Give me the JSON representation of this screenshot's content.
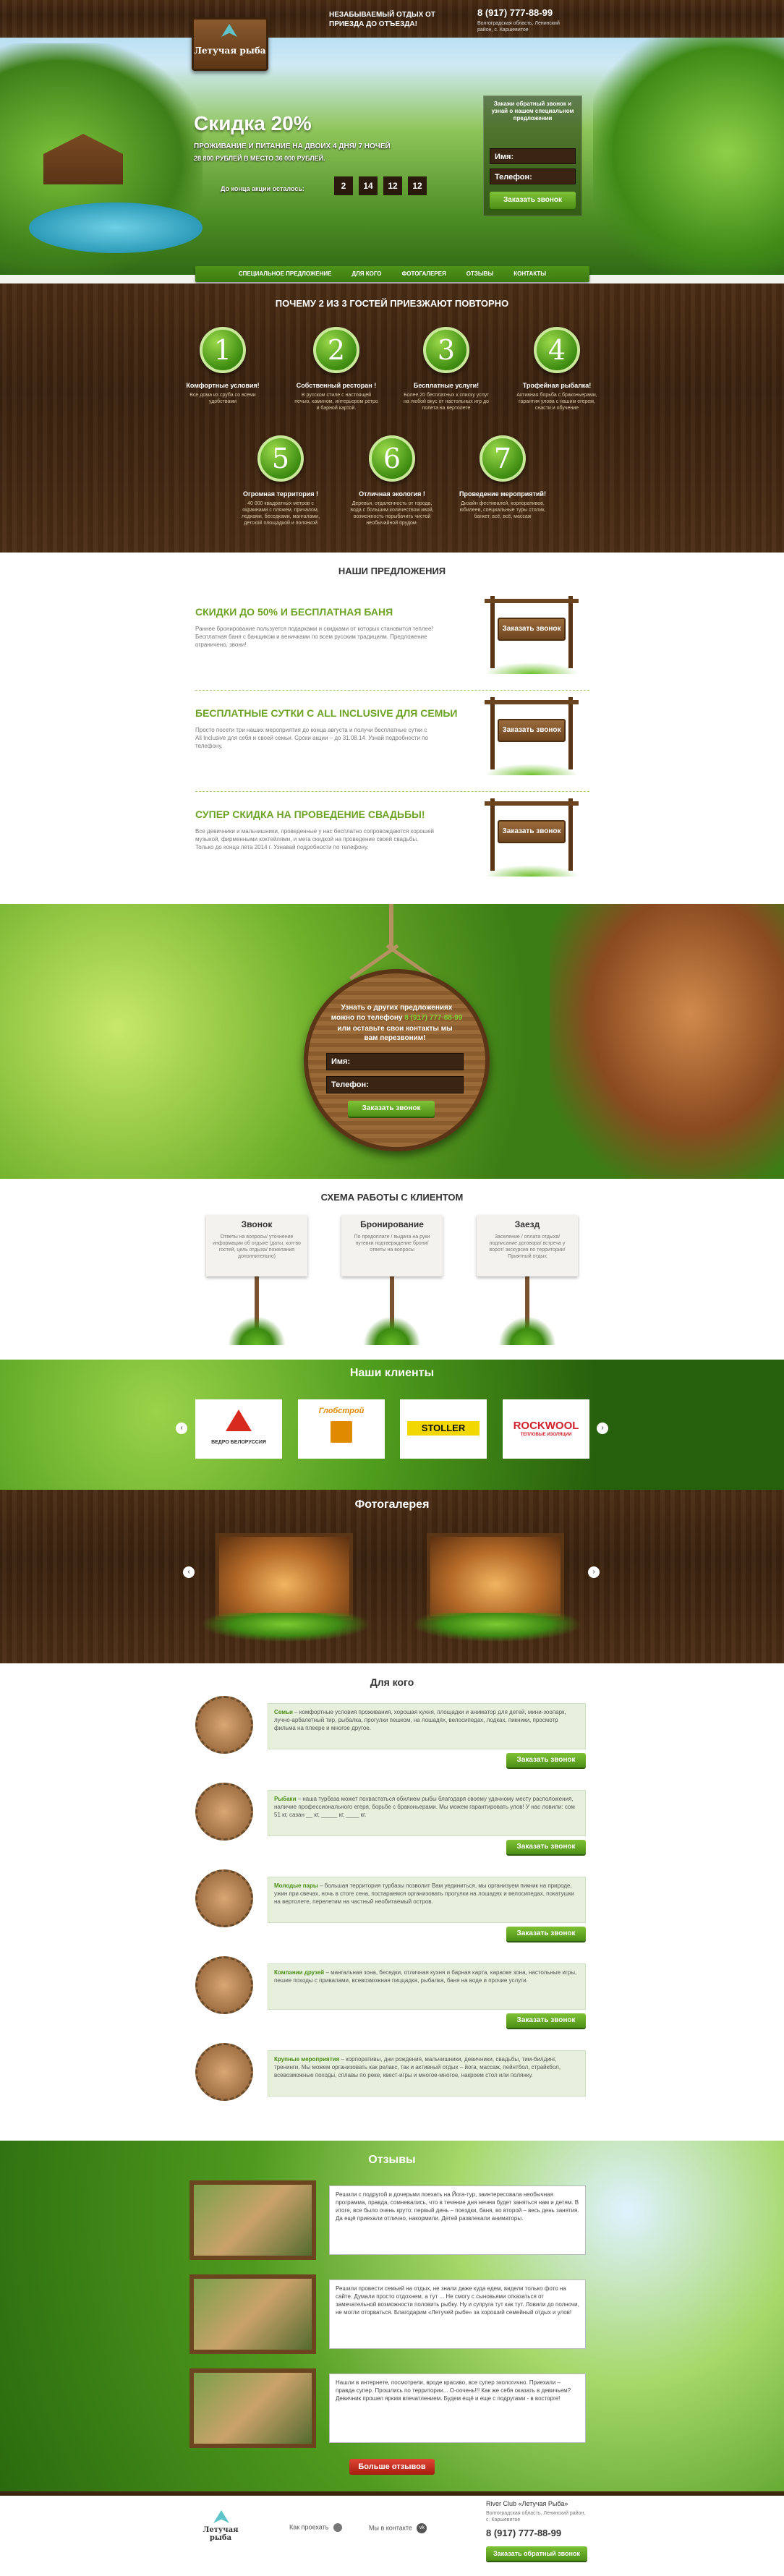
{
  "header": {
    "logo": "Летучая рыба",
    "tagline": "НЕЗАБЫВАЕМЫЙ ОТДЫХ ОТ ПРИЕЗДА ДО ОТЪЕЗДА!",
    "address": "Волгоградская область, Ленинский район, с. Каршевитое",
    "phone": "8 (917) 777-88-99"
  },
  "hero": {
    "discount": "Скидка 20%",
    "subtitle": "ПРОЖИВАНИЕ И ПИТАНИЕ НА ДВОИХ 4 ДНЯ/ 7 НОЧЕЙ",
    "price": "28 800 РУБЛЕЙ В МЕСТО  36 000 РУБЛЕЙ.",
    "countdown_label": "До конца акции осталось:",
    "countdown": [
      "2",
      "14",
      "12",
      "12"
    ],
    "form_title": "Закажи обратный звонок и узнай о нашем специальном предложении",
    "name_label": "Имя:",
    "phone_label": "Телефон:",
    "button": "Заказать звонок"
  },
  "nav": [
    "СПЕЦИАЛЬНОЕ ПРЕДЛОЖЕНИЕ",
    "ДЛЯ КОГО",
    "ФОТОГАЛЕРЕЯ",
    "ОТЗЫВЫ",
    "КОНТАКТЫ"
  ],
  "why": {
    "title": "ПОЧЕМУ 2 ИЗ 3 ГОСТЕЙ ПРИЕЗЖАЮТ ПОВТОРНО",
    "items": [
      {
        "num": "1",
        "title": "Комфортные условия!",
        "desc": "Все дома из сруба со всеми удобствами"
      },
      {
        "num": "2",
        "title": "Собственный ресторан !",
        "desc": "В русском стиле с настоящей печью, камином, интерьером ретро и барной картой."
      },
      {
        "num": "3",
        "title": "Бесплатные услуги!",
        "desc": "Более 20 бесплатных к списку услуг на любой вкус от настольных игр до полета на вертолете"
      },
      {
        "num": "4",
        "title": "Трофейная рыбалка!",
        "desc": "Активная борьба с браконьерами, гарантия улова с нашим егерем, снасти и обучение"
      },
      {
        "num": "5",
        "title": "Огромная территория !",
        "desc": "40 000 квадратных метров с окраинами с пляжем, причалом, лодками, беседками, мангалами, детской площадкой и полянкой"
      },
      {
        "num": "6",
        "title": "Отличная экология !",
        "desc": "Деревья, отдаленность от города, вода с большим количеством ивой, возможность порыбачить чистой необычайной прудом."
      },
      {
        "num": "7",
        "title": "Проведение мероприятий!",
        "desc": "Дизайн фестивалей, корпоративов, юбилеев, специальные туры столик, банкет, всё, всё, массаж"
      }
    ]
  },
  "offers": {
    "title": "НАШИ ПРЕДЛОЖЕНИЯ",
    "sign": "Заказать звонок",
    "items": [
      {
        "title": "СКИДКИ ДО 50% И БЕСПЛАТНАЯ БАНЯ",
        "desc": "Раннее бронирование пользуется подарками и скидками от которых становится теплее! Бесплатная баня с банщиком и веничками по всем русским традициям. Предложение ограничено, звони!"
      },
      {
        "title": "БЕСПЛАТНЫЕ СУТКИ С ALL INCLUSIVE ДЛЯ СЕМЬИ",
        "desc": "Просто посети три наших мероприятия до конца августа и получи бесплатные сутки с All Inclusive для себя и своей семьи. Сроки акции – до 31.08.14. Узнай подробности по телефону."
      },
      {
        "title": "СУПЕР СКИДКА НА ПРОВЕДЕНИЕ СВАДЬБЫ!",
        "desc": "Все девичники и мальчишники, проведенные у нас бесплатно сопровождаются хорошей музыкой, фирменными коктейлями, и мега скидкой на проведение своей свадьбы. Только до конца лета 2014 г. Узнавай подробности по телефону."
      }
    ]
  },
  "callback": {
    "text1": "Узнать о других предложениях",
    "text2": "можно по телефону",
    "phone": "8 (917) 777-88-99",
    "text3": "или оставьте свои контакты мы вам перезвоним!",
    "name_label": "Имя:",
    "phone_label": "Телефон:",
    "button": "Заказать звонок"
  },
  "scheme": {
    "title": "СХЕМА РАБОТЫ С КЛИЕНТОМ",
    "items": [
      {
        "title": "Звонок",
        "desc": "Ответы на вопросы/ уточнение информации об отдыхе (даты, кол-во гостей, цель отдыха/ пожелания дополнительно)"
      },
      {
        "title": "Бронирование",
        "desc": "По предоплате / выдача на руки путевки подтверждение брони/ ответы на вопросы"
      },
      {
        "title": "Заезд",
        "desc": "Заселение / оплата отдыха/ подписание договора/ встреча у ворот/ экскурсия по территории/ Приятный отдых"
      }
    ]
  },
  "clients": {
    "title": "Наши клиенты",
    "logos": [
      {
        "name": "ЛУКОЙЛ",
        "sub": "ВЕДРО БЕЛОРУССИЯ"
      },
      {
        "name": "Глобстрой",
        "sub": ""
      },
      {
        "name": "STOLLER",
        "sub": ""
      },
      {
        "name": "ROCKWOOL",
        "sub": "ТЕПЛОВЫЕ ИЗОЛЯЦИИ"
      }
    ]
  },
  "gallery": {
    "title": "Фотогалерея"
  },
  "who": {
    "title": "Для кого",
    "button": "Заказать звонок",
    "items": [
      {
        "label": "Семьи",
        "text": "– комфортные условия проживания, хорошая кухня, площадки и аниматор для детей, мини-зоопарк, лучно-арбалетный тир, рыбалка, прогулки пешком, на лошадях, велосипедах, лодках, пикники, просмотр фильма на плеере и многое другое."
      },
      {
        "label": "Рыбаки",
        "text": "– наша турбаза может похвастаться обилием рыбы благодаря своему удачному месту расположения, наличие профессионального егеря, борьбе с браконьерами. Мы можем гарантировать улов! У нас ловили: сом 51 кг, сазан __ кг, _____ кг, ____ кг."
      },
      {
        "label": "Молодые пары",
        "text": "– большая территория турбазы позволит Вам уединиться, мы организуем пикник на природе, ужин при свечах, ночь в стоге сена, постараемся организовать прогулки на лошадях и велосипедах, покатушки на вертолете, перелетим на частный необитаемый остров."
      },
      {
        "label": "Компании друзей",
        "text": "– мангальная зона, беседки, отличная кухня и барная карта, караоке зона, настольные игры, пешие походы с привалами, всевозможная пиццадка, рыбалка, баня на воде и прочие услуги."
      },
      {
        "label": "Крупные мероприятия",
        "text": "– корпоративы, дни рождения, мальчишники, девичники, свадьбы, тим-билдинг, тренинги. Мы можем организовать как релакс, так и активный отдых – йога, массаж, пейнтбол, страйкбол, всевозможные походы, сплавы по реке, квест-игры и многое-многое, накроем стол или полянку."
      }
    ]
  },
  "reviews": {
    "title": "Отзывы",
    "more": "Больше отзывов",
    "items": [
      "Решили с подругой и дочерьми поехать на Йога-тур, заинтересовала необычная программа, правда, сомневались, что в течение дня нечем будет заняться нам и детям. В итоге, все было очень круто: первый день – поездки, баня, во второй – весь день занятия. Да ещё приехали отлично, накормили. Детей развлекали аниматоры.",
      "Решили провести семьей на отдых, не знали даже куда едем, видели только фото на сайте. Думали просто отдохнем, а тут ... Не смогу с сыновьями отказаться от замечательной возможности половить рыбку. Ну и супруга тут как тут. Ловили до полночи, не могли оторваться. Благодарим «Летучей рыбе» за хороший семейный отдых и улов!",
      "Нашли в интернете, посмотрели, вроде красиво, все супер экологично. Приехали – правда супер. Прошлись по территории... О-оочень!!! Как же себя оказать в девичьем? Девичник прошел ярким впечатлением. Будем ещё и еще с подругами - в восторге!"
    ]
  },
  "footer": {
    "how_to_get": "Как проехать",
    "vk": "Мы в контакте",
    "club": "River Club «Летучая Рыба»",
    "address": "Волгоградская область, Ленинский район, с. Каршевитое",
    "phone": "8 (917) 777-88-99",
    "button": "Заказать обратный звонок"
  }
}
